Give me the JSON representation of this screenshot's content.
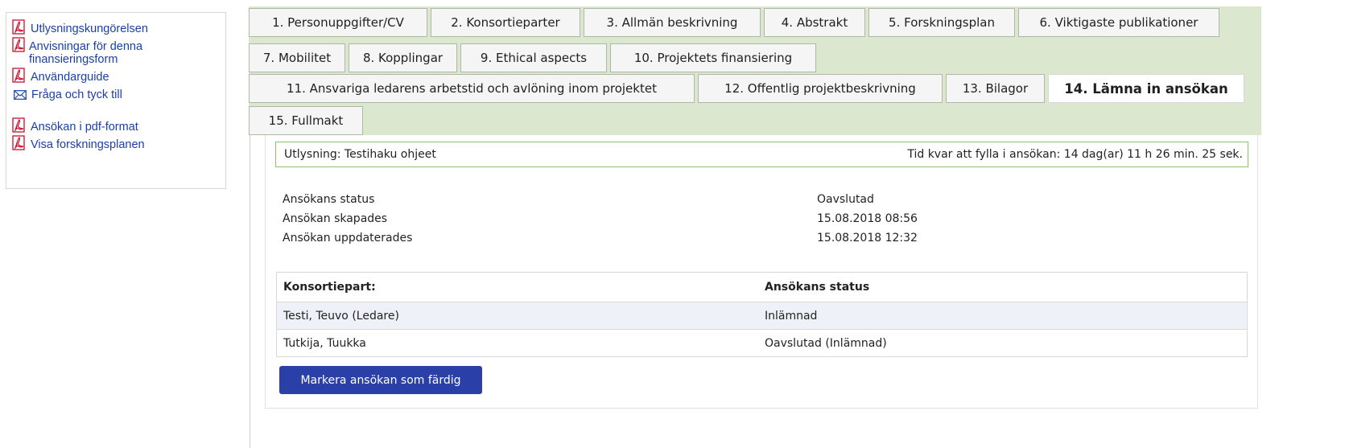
{
  "sidebar": {
    "links": [
      {
        "label": "Utlysningskungörelsen",
        "icon": "pdf-icon"
      },
      {
        "label": "Anvisningar för denna finansieringsform",
        "icon": "pdf-icon"
      },
      {
        "label": "Användarguide",
        "icon": "pdf-icon"
      },
      {
        "label": "Fråga och tyck till",
        "icon": "mail-icon"
      },
      {
        "label": "Ansökan i pdf-format",
        "icon": "pdf-icon"
      },
      {
        "label": "Visa forskningsplanen",
        "icon": "pdf-icon"
      }
    ]
  },
  "tabs": {
    "row1": [
      "1. Personuppgifter/CV",
      "2. Konsortieparter",
      "3. Allmän beskrivning",
      "4. Abstrakt",
      "5. Forskningsplan",
      "6. Viktigaste publikationer"
    ],
    "row2": [
      "7. Mobilitet",
      "8. Kopplingar",
      "9. Ethical aspects",
      "10. Projektets finansiering"
    ],
    "row3": [
      "11. Ansvariga ledarens arbetstid och avlöning inom projektet",
      "12. Offentlig projektbeskrivning",
      "13. Bilagor",
      "14. Lämna in ansökan"
    ],
    "row4": [
      "15. Fullmakt"
    ],
    "active": "14. Lämna in ansökan"
  },
  "call": {
    "label": "Utlysning: Testihaku ohjeet",
    "time_left": "Tid kvar att fylla i ansökan: 14 dag(ar) 11 h 26 min. 25 sek."
  },
  "application_info": [
    {
      "label": "Ansökans status",
      "value": "Oavslutad"
    },
    {
      "label": "Ansökan skapades",
      "value": "15.08.2018 08:56"
    },
    {
      "label": "Ansökan uppdaterades",
      "value": "15.08.2018 12:32"
    }
  ],
  "consortium_table": {
    "headers": [
      "Konsortiepart:",
      "Ansökans status"
    ],
    "rows": [
      [
        "Testi, Teuvo (Ledare)",
        "Inlämnad"
      ],
      [
        "Tutkija, Tuukka",
        "Oavslutad (Inlämnad)"
      ]
    ]
  },
  "submit_button": "Markera ansökan som färdig",
  "colors": {
    "tab_area_bg": "#dbe8cf",
    "link": "#1a3fa8",
    "button": "#2a40a8",
    "call_box_border": "#8dc26d",
    "pdf_icon": "#c8102e"
  }
}
